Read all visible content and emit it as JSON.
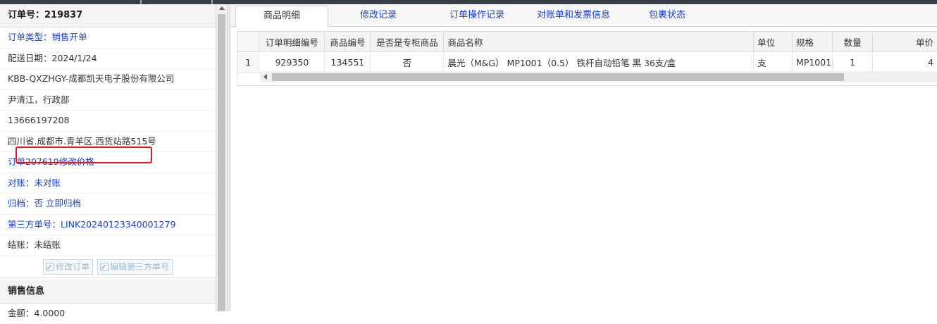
{
  "order": {
    "title": "订单号：219837",
    "type_label": "订单类型：",
    "type_value": "销售开单",
    "delivery_date": "配送日期：2024/1/24",
    "customer": "KBB-QXZHGY-成都凯天电子股份有限公司",
    "contact": "尹清江，行政部",
    "phone": "13666197208",
    "address": "四川省.成都市.青羊区.西货站路515号",
    "change_note": "订单207619修改价格",
    "reconcile": "对账：未对账",
    "archive_label": "归档：",
    "archive_value": "否 立即归档",
    "third_party": "第三方单号：LINK20240123340001279",
    "settle": "结账：未结账",
    "btn_edit_order": "修改订单",
    "btn_edit_third": "编辑第三方单号"
  },
  "sales": {
    "title": "销售信息",
    "amount": "金额：4.0000"
  },
  "tabs": [
    {
      "label": "商品明细",
      "active": true
    },
    {
      "label": "修改记录"
    },
    {
      "label": "订单操作记录"
    },
    {
      "label": "对账单和发票信息"
    },
    {
      "label": "包裹状态"
    }
  ],
  "grid": {
    "headers": [
      "订单明细编号",
      "商品编号",
      "是否是专柜商品",
      "商品名称",
      "单位",
      "规格",
      "数量",
      "单价"
    ],
    "rows": [
      {
        "index": "1",
        "detail_no": "929350",
        "product_no": "134551",
        "is_counter": "否",
        "name": "晨光（M&G） MP1001（0.5） 铁杆自动铅笔 黑 36支/盒",
        "unit": "支",
        "spec": "MP1001",
        "qty": "1",
        "price": "4"
      }
    ]
  },
  "colors": {
    "link": "#1a3fc8",
    "highlight": "#e4161b"
  }
}
